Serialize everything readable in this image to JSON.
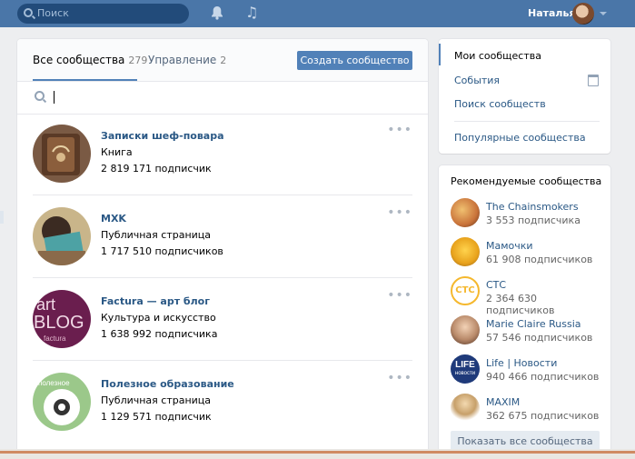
{
  "header": {
    "search_placeholder": "Поиск",
    "user_name": "Наталья"
  },
  "tabs": [
    {
      "label": "Все сообщества",
      "count": "279"
    },
    {
      "label": "Управление",
      "count": "2"
    }
  ],
  "create_button": "Создать сообщество",
  "communities": [
    {
      "name": "Записки шеф-повара",
      "type": "Книга",
      "subs": "2 819 171 подписчик"
    },
    {
      "name": "MXK",
      "type": "Публичная страница",
      "subs": "1 717 510 подписчиков"
    },
    {
      "name": "Factura — арт блог",
      "type": "Культура и искусство",
      "subs": "1 638 992 подписчика"
    },
    {
      "name": "Полезное образование",
      "type": "Публичная страница",
      "subs": "1 129 571 подписчик"
    }
  ],
  "avatar_text": {
    "factura_line1": "art",
    "factura_line2": "BLOG",
    "factura_line3": "factura",
    "poleznoe": "полезное",
    "ctc": "СТС",
    "life1": "LIFE",
    "life2": "новости"
  },
  "menu": {
    "my": "Мои сообщества",
    "events": "События",
    "search": "Поиск сообществ",
    "popular": "Популярные сообщества"
  },
  "recommended": {
    "title": "Рекомендуемые сообщества",
    "items": [
      {
        "name": "The Chainsmokers",
        "subs": "3 553 подписчика"
      },
      {
        "name": "Мамочки",
        "subs": "61 908 подписчиков"
      },
      {
        "name": "СТС",
        "subs": "2 364 630 подписчиков"
      },
      {
        "name": "Marie Claire Russia",
        "subs": "57 546 подписчиков"
      },
      {
        "name": "Life | Новости",
        "subs": "940 466 подписчиков"
      },
      {
        "name": "MAXIM",
        "subs": "362 675 подписчиков"
      }
    ],
    "show_all": "Показать все сообщества"
  },
  "colors": {
    "header_bg": "#4a76a8",
    "link": "#2a5885",
    "button": "#5181b8"
  },
  "icons": [
    "search-icon",
    "bell-icon",
    "music-icon",
    "caret-down-icon",
    "calendar-icon",
    "more-dots-icon"
  ]
}
